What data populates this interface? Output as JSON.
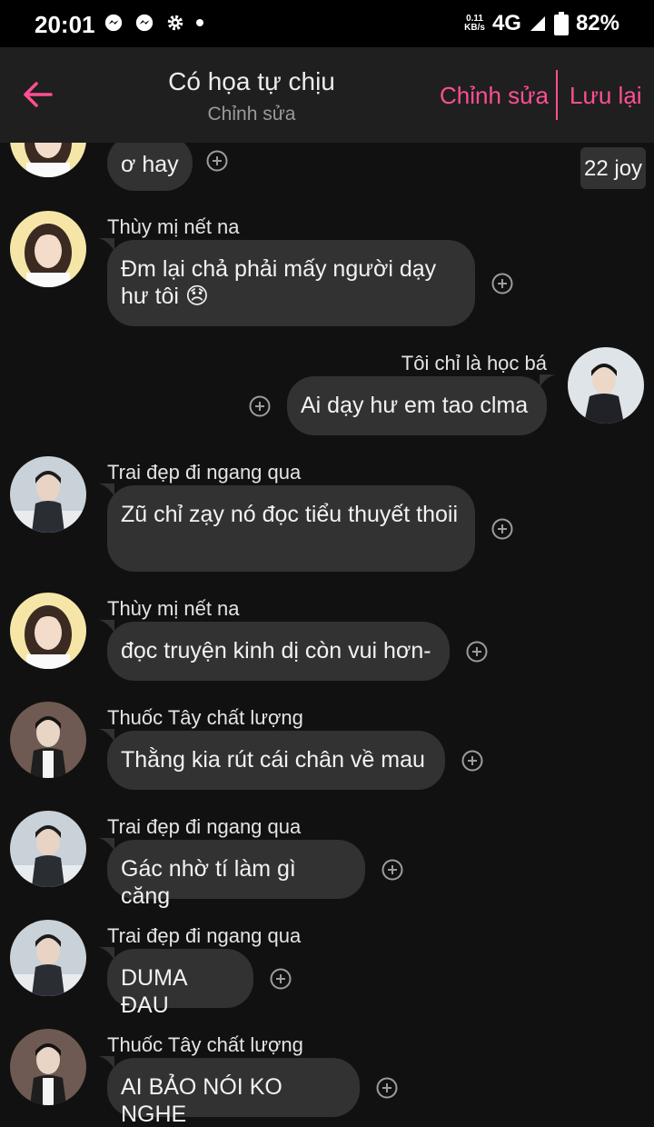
{
  "status_bar": {
    "time": "20:01",
    "speed_value": "0.11",
    "speed_unit": "KB/s",
    "network": "4G",
    "battery": "82%",
    "icons": [
      "messenger-icon",
      "messenger-icon",
      "gear-icon",
      "dot-icon",
      "signal-icon",
      "battery-icon"
    ]
  },
  "header": {
    "title": "Có họa tự chịu",
    "subtitle": "Chỉnh sửa",
    "edit_label": "Chỉnh sửa",
    "save_label": "Lưu lại",
    "accent_color": "#ff4f93"
  },
  "chat": {
    "partial_message": {
      "text": "ơ hay",
      "tag": "22 joy"
    },
    "messages": [
      {
        "sender": "Thùy mị nết na",
        "text": "Đm lại chả phải mấy người dạy hư tôi 😞",
        "side": "left"
      },
      {
        "sender": "Tôi chỉ là học bá",
        "text": "Ai dạy hư em tao clma",
        "side": "right"
      },
      {
        "sender": "Trai đẹp đi ngang qua",
        "text": "Zũ chỉ zạy nó đọc tiểu thuyết thoii",
        "side": "left"
      },
      {
        "sender": "Thùy mị nết na",
        "text": "đọc truyện kinh dị còn vui hơn-",
        "side": "left"
      },
      {
        "sender": "Thuốc Tây chất lượng",
        "text": "Thằng kia rút cái chân về mau",
        "side": "left"
      },
      {
        "sender": "Trai đẹp đi ngang qua",
        "text": "Gác nhờ tí làm gì căng",
        "side": "left"
      },
      {
        "sender": "Trai đẹp đi ngang qua",
        "text": "DUMA ĐAU",
        "side": "left"
      },
      {
        "sender": "Thuốc Tây chất lượng",
        "text": "AI BẢO NÓI KO NGHE",
        "side": "left"
      }
    ]
  }
}
